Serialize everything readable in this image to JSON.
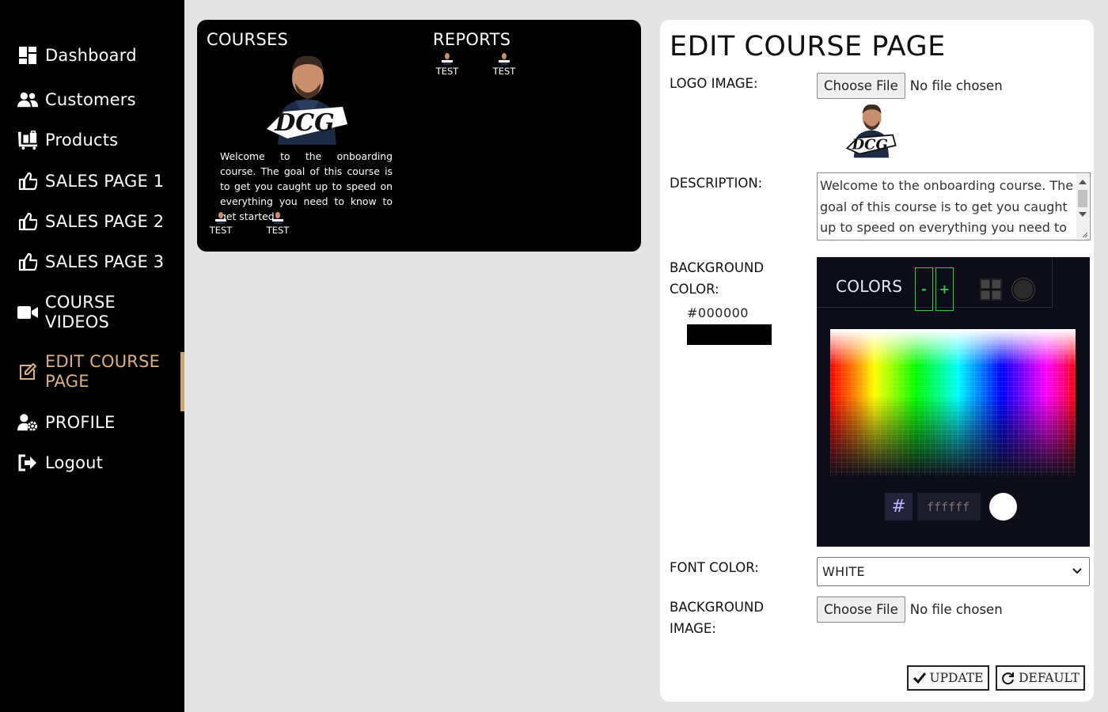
{
  "sidebar": {
    "items": [
      {
        "label": "Dashboard",
        "icon": "dashboard-icon"
      },
      {
        "label": "Customers",
        "icon": "users-icon"
      },
      {
        "label": "Products",
        "icon": "luggage-cart-icon"
      },
      {
        "label": "SALES PAGE 1",
        "icon": "thumbs-up-icon"
      },
      {
        "label": "SALES PAGE 2",
        "icon": "thumbs-up-icon"
      },
      {
        "label": "SALES PAGE 3",
        "icon": "thumbs-up-icon"
      },
      {
        "label": "COURSE VIDEOS",
        "icon": "video-camera-icon"
      },
      {
        "label": "EDIT COURSE PAGE",
        "icon": "edit-icon",
        "active": true
      },
      {
        "label": "PROFILE",
        "icon": "user-gear-icon"
      },
      {
        "label": "Logout",
        "icon": "sign-out-icon"
      }
    ]
  },
  "preview": {
    "courses_heading": "COURSES",
    "reports_heading": "REPORTS",
    "description": "Welcome to the onboarding course. The goal of this course is to get you caught up to speed on everything you need to know to get started!",
    "thumbs": [
      {
        "label": "TEST"
      },
      {
        "label": "TEST"
      },
      {
        "label": "TEST"
      },
      {
        "label": "TEST"
      }
    ]
  },
  "editor": {
    "title": "EDIT COURSE PAGE",
    "logo_label": "LOGO IMAGE:",
    "logo_button": "Choose File",
    "logo_status": "No file chosen",
    "description_label": "DESCRIPTION:",
    "description_value": "Welcome to the onboarding course. The goal of this course is to get you caught up to speed on everything you need to know to get started!",
    "bg_color_label": "BACKGROUND COLOR:",
    "bg_color_value": "#000000",
    "picker": {
      "title": "COLORS",
      "minus": "-",
      "plus": "+",
      "hash": "#",
      "hex_placeholder": "ffffff"
    },
    "font_color_label": "FONT COLOR:",
    "font_color_value": "WHITE",
    "bg_image_label": "BACKGROUND IMAGE:",
    "bg_image_button": "Choose File",
    "bg_image_status": "No file chosen",
    "update_button": "UPDATE",
    "default_button": "DEFAULT"
  },
  "colors": {
    "sidebar_bg": "#000000",
    "active_accent": "#d9b27c",
    "page_bg": "#e4e4e4",
    "picker_bg": "#0d0d1a",
    "picker_accent": "#2ecc40"
  }
}
